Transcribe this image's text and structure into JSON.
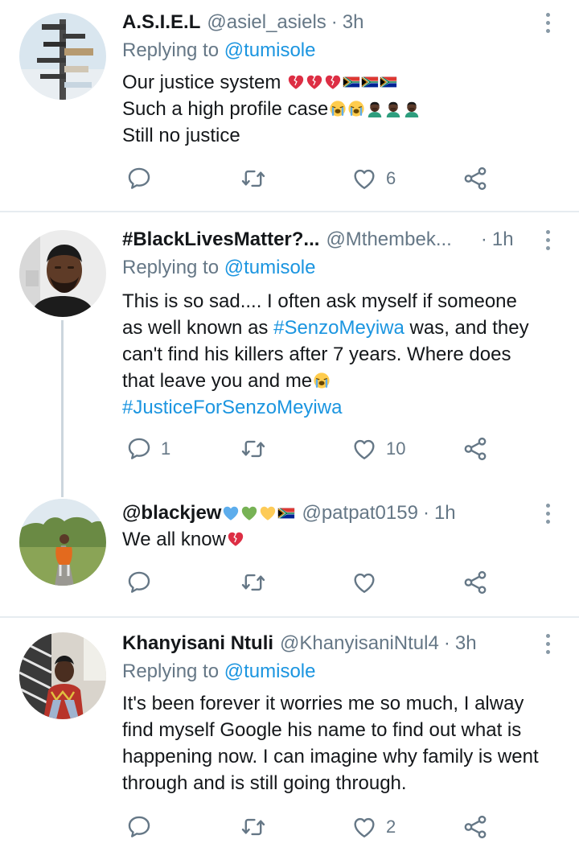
{
  "tweets": [
    {
      "name": "A.S.I.E.L",
      "handle": "@asiel_asiels",
      "time": "3h",
      "replying_prefix": "Replying to ",
      "replying_to": "@tumisole",
      "lines": [
        "Our justice system ",
        "Such a high profile case",
        "Still no justice"
      ],
      "replies": "",
      "likes": "6"
    },
    {
      "name": "#BlackLivesMatter?...",
      "handle": "@Mthembek...",
      "time": "1h",
      "replying_prefix": "Replying to ",
      "replying_to": "@tumisole",
      "lines": [
        "This is so sad.... I often ask myself if someone",
        "as well known as ",
        "#SenzoMeyiwa",
        " was, and they",
        "can't find his killers after 7 years. Where does",
        "that leave you and me",
        "#JusticeForSenzoMeyiwa"
      ],
      "replies": "1",
      "likes": "10"
    },
    {
      "name": "@blackjew",
      "handle": "@patpat0159",
      "time": "1h",
      "lines": [
        "We all know"
      ],
      "replies": "",
      "likes": ""
    },
    {
      "name": "Khanyisani Ntuli",
      "handle": "@KhanyisaniNtul4",
      "time": "3h",
      "replying_prefix": "Replying to ",
      "replying_to": "@tumisole",
      "lines": [
        "It's been forever it worries me so much, I alway",
        "find myself Google his name to find out what is",
        "happening now. I can imagine why family is went",
        "through and is still going through."
      ],
      "replies": "",
      "likes": "2"
    }
  ],
  "separator": "·",
  "icons": {
    "reply": "reply-icon",
    "retweet": "retweet-icon",
    "like": "heart-icon",
    "share": "share-icon",
    "more": "more-vertical-icon",
    "broken_heart": "broken-heart-emoji",
    "sa_flag": "south-africa-flag-emoji",
    "crying": "loudly-crying-face-emoji",
    "facepalm": "person-facepalming-emoji",
    "blue_heart": "blue-heart-emoji",
    "green_heart": "green-heart-emoji",
    "yellow_heart": "yellow-heart-emoji"
  },
  "colors": {
    "link": "#1b95e0",
    "secondary_text": "#657786",
    "icon_gray": "#657786",
    "divider": "#e6ecf0"
  }
}
